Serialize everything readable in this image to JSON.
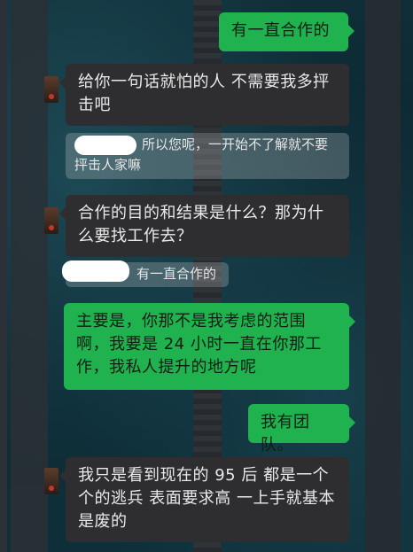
{
  "messages": {
    "m1": "有一直合作的",
    "m2": "给你一句话就怕的人  不需要我多抨击吧",
    "m3_quote": "所以您呢，一开始不了解就不要抨击人家嘛",
    "m4": "合作的目的和结果是什么？那为什么要找工作去？",
    "m5_quote": "有一直合作的",
    "m6": "主要是，你那不是我考虑的范围啊，我要是 24 小时一直在你那工作，我私人提升的地方呢",
    "m7": "我有团队。",
    "m8": "我只是看到现在的 95 后 都是一个个的逃兵 表面要求高 一上手就基本是废的"
  },
  "colors": {
    "outgoing_bubble": "#1fb24f",
    "incoming_bubble": "#2e2e30"
  }
}
